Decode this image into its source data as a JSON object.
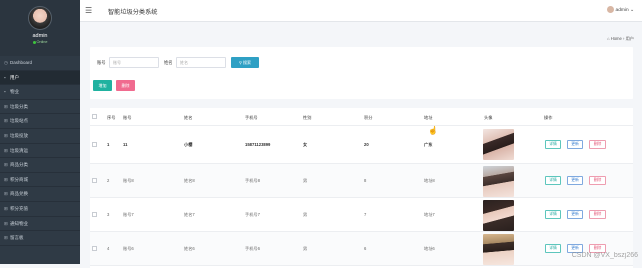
{
  "sidebar": {
    "user_name": "admin",
    "user_status": "Online",
    "items": [
      {
        "label": "Dashboard",
        "icon": "dashboard-icon"
      },
      {
        "label": "用户",
        "icon": "user-icon"
      },
      {
        "label": "物业",
        "icon": "home-icon"
      },
      {
        "label": "垃圾分类",
        "icon": "tag-icon"
      },
      {
        "label": "垃圾站点",
        "icon": "tag-icon"
      },
      {
        "label": "垃圾投放",
        "icon": "tag-icon"
      },
      {
        "label": "垃圾清运",
        "icon": "tag-icon"
      },
      {
        "label": "商品分类",
        "icon": "tag-icon"
      },
      {
        "label": "积分商城",
        "icon": "tag-icon"
      },
      {
        "label": "商品兑换",
        "icon": "tag-icon"
      },
      {
        "label": "积分充值",
        "icon": "tag-icon"
      },
      {
        "label": "通知物业",
        "icon": "tag-icon"
      },
      {
        "label": "留言板",
        "icon": "tag-icon"
      }
    ]
  },
  "header": {
    "title": "智能垃圾分类系统",
    "user": "admin"
  },
  "breadcrumb": {
    "home": "Home",
    "current": "用户"
  },
  "search": {
    "account_label": "账号",
    "account_placeholder": "账号",
    "name_label": "姓名",
    "name_placeholder": "姓名",
    "search_button": "搜索",
    "add_button": "增加",
    "delete_button": "删除"
  },
  "table": {
    "columns": [
      "序号",
      "账号",
      "姓名",
      "手机号",
      "性别",
      "积分",
      "地址",
      "头像",
      "操作"
    ],
    "rows": [
      {
        "index": "1",
        "account": "11",
        "name": "小樱",
        "phone": "15871123899",
        "gender": "女",
        "points": "20",
        "address": "广东",
        "bold": true
      },
      {
        "index": "2",
        "account": "账号8",
        "name": "姓名8",
        "phone": "手机号8",
        "gender": "男",
        "points": "8",
        "address": "地址8",
        "bold": false
      },
      {
        "index": "3",
        "account": "账号7",
        "name": "姓名7",
        "phone": "手机号7",
        "gender": "男",
        "points": "7",
        "address": "地址7",
        "bold": false
      },
      {
        "index": "4",
        "account": "账号6",
        "name": "姓名6",
        "phone": "手机号6",
        "gender": "男",
        "points": "6",
        "address": "地址6",
        "bold": false
      }
    ],
    "actions": {
      "detail": "详情",
      "edit": "更新",
      "delete": "删除"
    }
  },
  "watermark": "CSDN @VX_bszj266"
}
